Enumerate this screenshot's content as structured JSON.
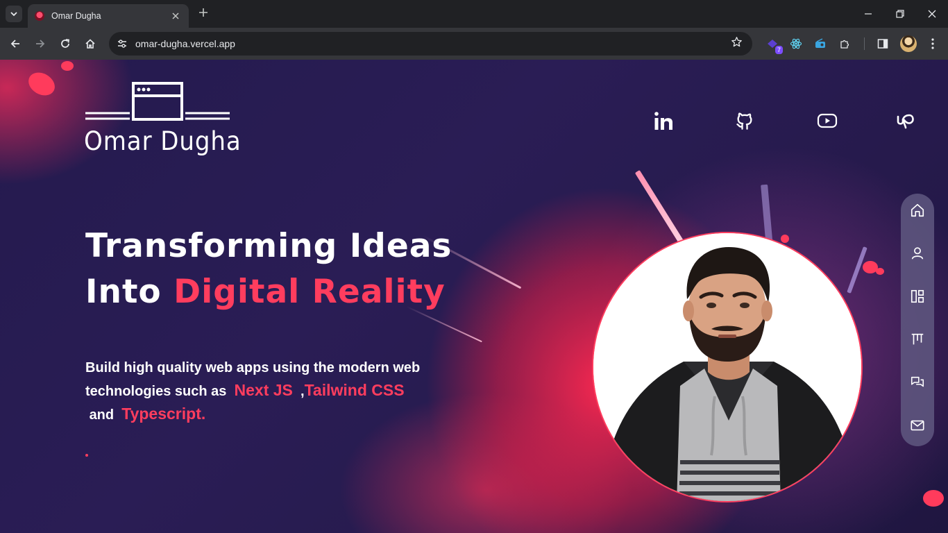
{
  "browser": {
    "tab_title": "Omar Dugha",
    "url": "omar-dugha.vercel.app",
    "extension_badge": "7",
    "icons": {
      "tab_search": "chevron-down-icon",
      "tab_close": "close-icon",
      "new_tab": "plus-icon",
      "minimize": "minimize-icon",
      "restore": "restore-icon",
      "close_window": "close-icon",
      "back": "arrow-left-icon",
      "forward": "arrow-right-icon",
      "reload": "reload-icon",
      "home": "home-icon",
      "site_info": "tune-icon",
      "bookmark": "star-icon",
      "extensions": "puzzle-icon",
      "side_panel": "side-panel-icon",
      "menu": "kebab-menu-icon"
    }
  },
  "site": {
    "logo_text": "Omar Dugha",
    "social_links": [
      {
        "name": "linkedin",
        "icon": "linkedin-icon"
      },
      {
        "name": "github",
        "icon": "github-icon"
      },
      {
        "name": "youtube",
        "icon": "youtube-icon"
      },
      {
        "name": "upwork",
        "icon": "upwork-icon"
      }
    ],
    "headline": {
      "line1": "Transforming Ideas",
      "line2_prefix": "Into",
      "line2_accent": "Digital Reality"
    },
    "description": {
      "text1": "Build high quality web apps using the modern web technologies such as",
      "tech1": "Next JS",
      "separator": ",",
      "tech2": "Tailwind CSS",
      "and": "and",
      "tech3": "Typescript."
    },
    "side_nav": [
      {
        "name": "home",
        "icon": "home-icon"
      },
      {
        "name": "about",
        "icon": "user-icon"
      },
      {
        "name": "projects",
        "icon": "layout-icon"
      },
      {
        "name": "experience",
        "icon": "timeline-icon"
      },
      {
        "name": "testimonials",
        "icon": "chat-icon"
      },
      {
        "name": "contact",
        "icon": "mail-icon"
      }
    ],
    "colors": {
      "accent": "#ff3d5e",
      "background": "#261a4c",
      "text": "#ffffff"
    }
  }
}
